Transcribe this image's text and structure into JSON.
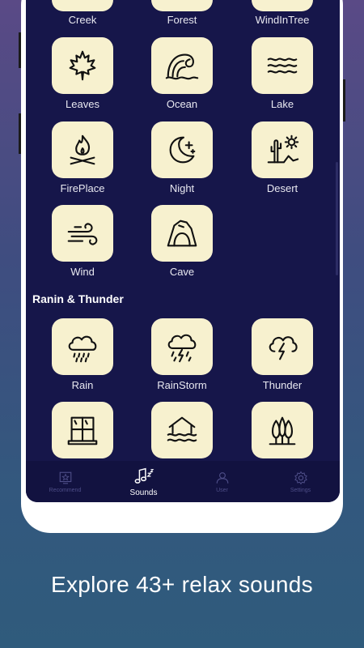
{
  "sounds": {
    "top_row": [
      "Creek",
      "Forest",
      "WindInTree"
    ],
    "nature": [
      {
        "label": "Leaves",
        "icon": "maple-leaf-icon"
      },
      {
        "label": "Ocean",
        "icon": "wave-icon"
      },
      {
        "label": "Lake",
        "icon": "lake-waves-icon"
      },
      {
        "label": "FirePlace",
        "icon": "campfire-icon"
      },
      {
        "label": "Night",
        "icon": "moon-stars-icon"
      },
      {
        "label": "Desert",
        "icon": "cactus-sun-icon"
      },
      {
        "label": "Wind",
        "icon": "wind-icon"
      },
      {
        "label": "Cave",
        "icon": "cave-icon"
      }
    ],
    "section_rain_title": "Ranin & Thunder",
    "rain": [
      {
        "label": "Rain",
        "icon": "rain-cloud-icon"
      },
      {
        "label": "RainStorm",
        "icon": "storm-cloud-icon"
      },
      {
        "label": "Thunder",
        "icon": "thunder-cloud-icon"
      },
      {
        "label": "",
        "icon": "window-icon"
      },
      {
        "label": "",
        "icon": "house-flood-icon"
      },
      {
        "label": "",
        "icon": "trees-icon"
      }
    ]
  },
  "tabs": [
    {
      "label": "Recommend",
      "icon": "star-frame-icon",
      "active": false
    },
    {
      "label": "Sounds",
      "icon": "music-note-icon",
      "active": true
    },
    {
      "label": "User",
      "icon": "user-icon",
      "active": false
    },
    {
      "label": "Settings",
      "icon": "gear-icon",
      "active": false
    }
  ],
  "caption": "Explore 43+ relax sounds",
  "colors": {
    "screen_bg": "#16164a",
    "tile_bg": "#f7f1cf",
    "active_tab": "#ffffff",
    "inactive_tab": "#4e4e88"
  }
}
